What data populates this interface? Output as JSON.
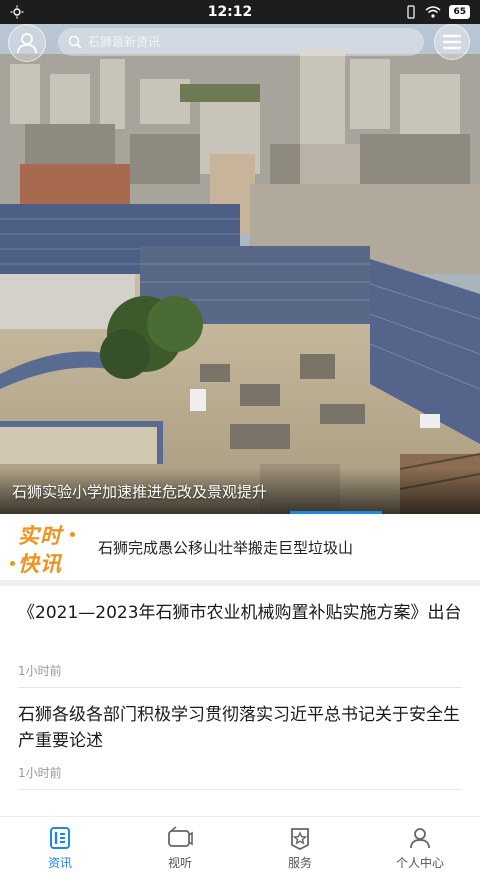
{
  "status_bar": {
    "time": "12:12",
    "battery": "65"
  },
  "header": {
    "search_placeholder": "石狮最新资讯",
    "icons": {
      "avatar": "user-icon",
      "search": "search-icon",
      "menu": "menu-icon"
    }
  },
  "hero": {
    "caption": "石狮实验小学加速推进危改及景观提升"
  },
  "flash_news": {
    "logo_line1": "实时",
    "logo_line2": "快讯",
    "headline": "石狮完成愚公移山壮举搬走巨型垃圾山",
    "logo_color": "#f0931e"
  },
  "news": [
    {
      "title": "《2021—2023年石狮市农业机械购置补贴实施方案》出台",
      "time": "1小时前"
    },
    {
      "title": "石狮各级各部门积极学习贯彻落实习近平总书记关于安全生产重要论述",
      "time": "1小时前"
    }
  ],
  "bottom_nav": [
    {
      "label": "资讯",
      "icon": "news-icon",
      "active": true
    },
    {
      "label": "视听",
      "icon": "video-icon",
      "active": false
    },
    {
      "label": "服务",
      "icon": "service-star-icon",
      "active": false
    },
    {
      "label": "个人中心",
      "icon": "profile-icon",
      "active": false
    }
  ],
  "colors": {
    "accent": "#1e88e5",
    "flash_orange": "#f0931e"
  }
}
